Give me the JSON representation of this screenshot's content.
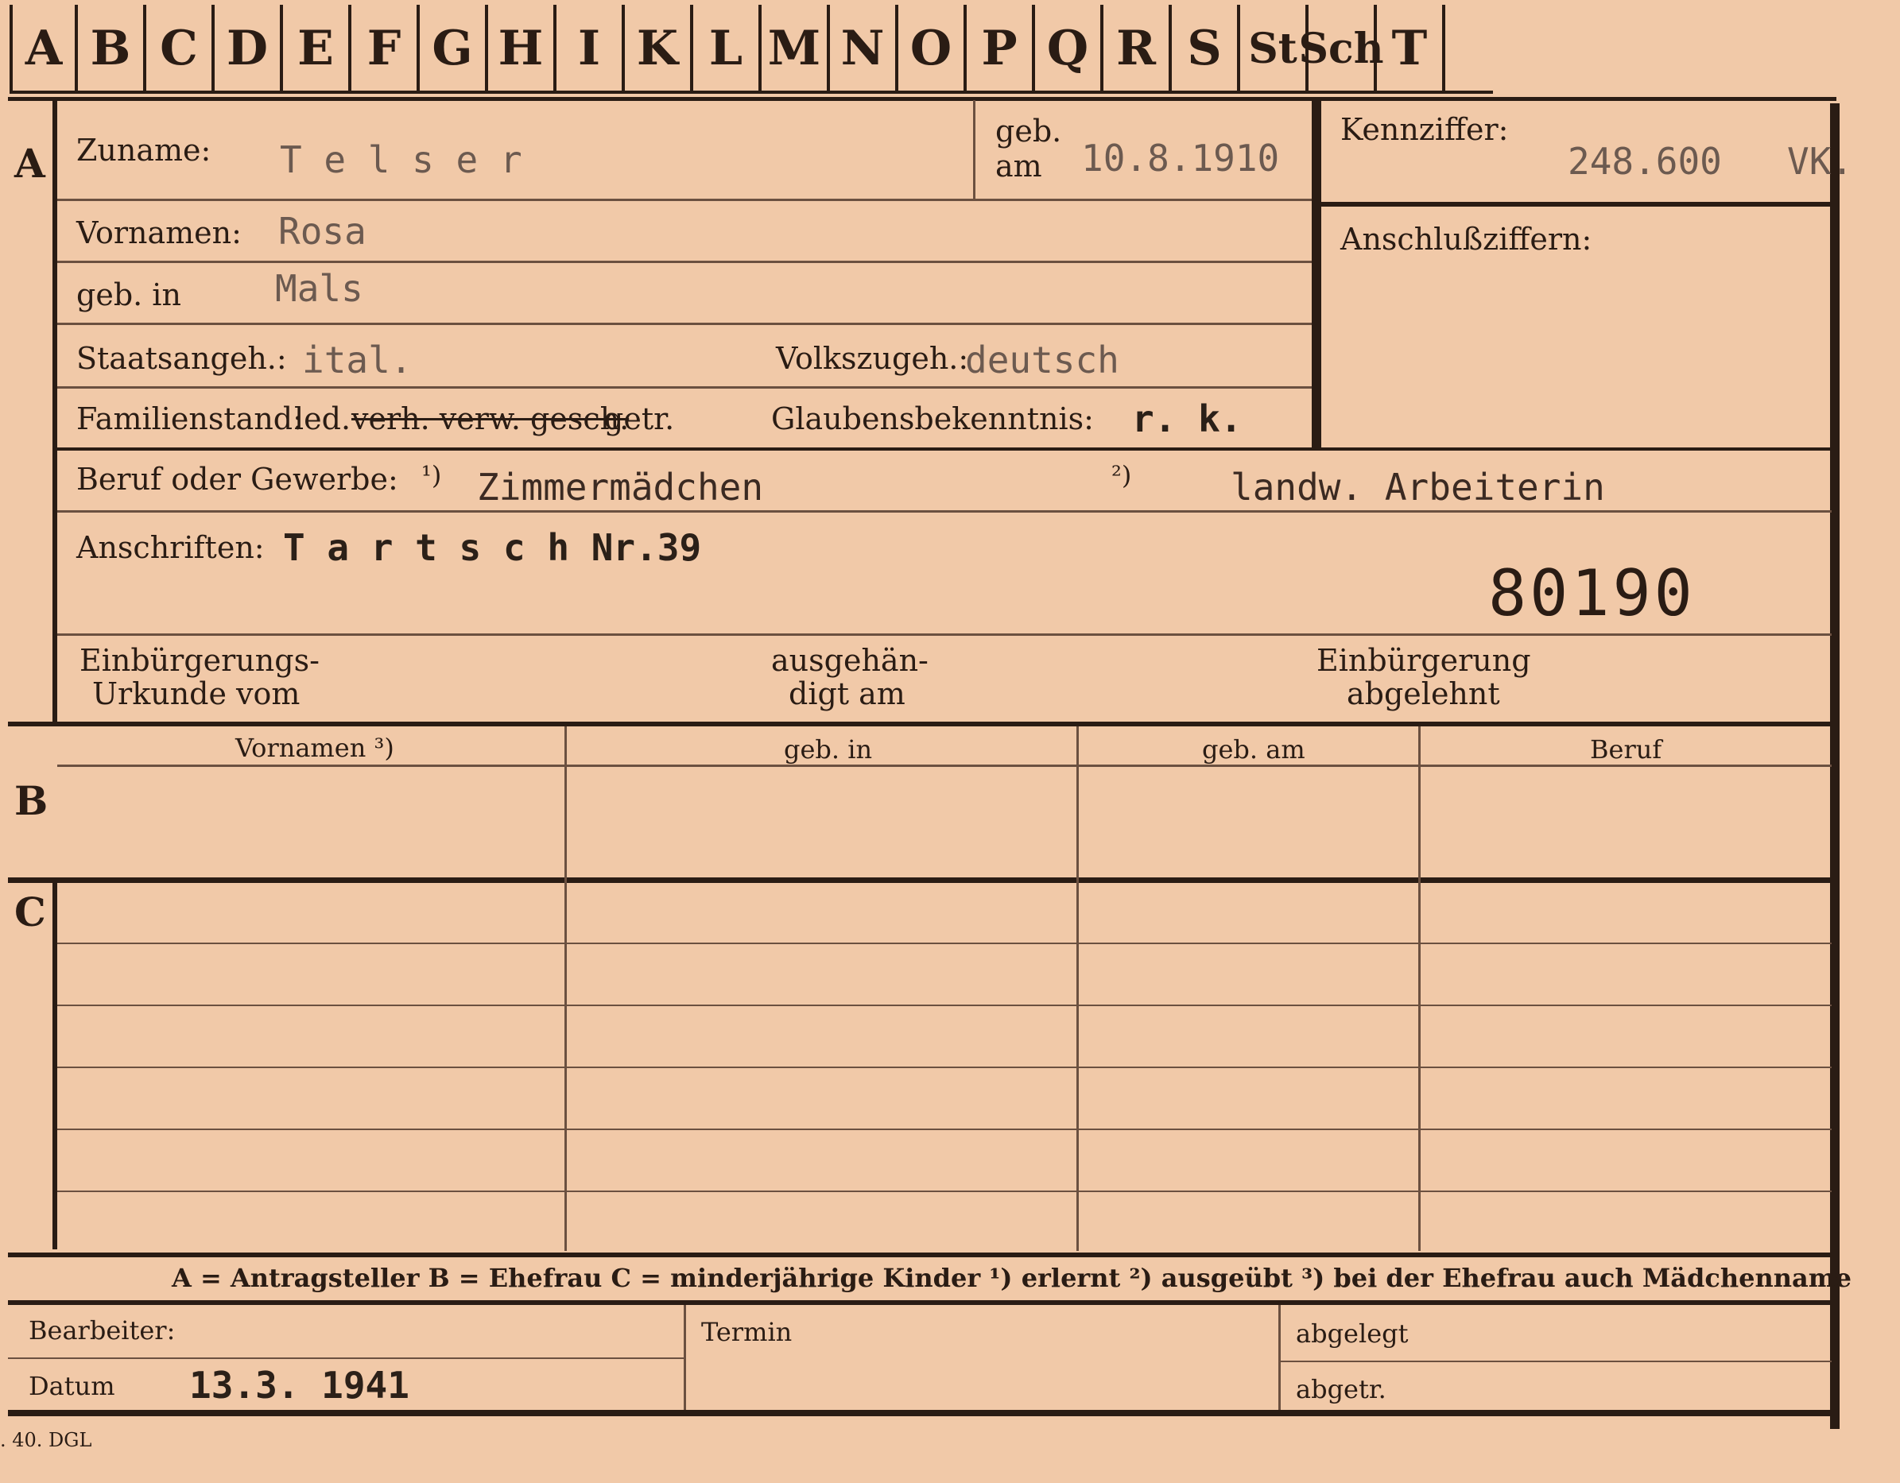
{
  "tabs": [
    "A",
    "B",
    "C",
    "D",
    "E",
    "F",
    "G",
    "H",
    "I",
    "K",
    "L",
    "M",
    "N",
    "O",
    "P",
    "Q",
    "R",
    "S",
    "St",
    "Sch",
    "T"
  ],
  "sections": {
    "a": "A",
    "b": "B",
    "c": "C"
  },
  "form": {
    "zuname_label": "Zuname:",
    "zuname_value": "T e l s e r",
    "geb_label": "geb.",
    "am_label": "am",
    "geb_am_value": "10.8.1910",
    "kennziffer_label": "Kennziffer:",
    "kennziffer_value": "248.600",
    "kennziffer_suffix": "VK.",
    "anschlussziffern_label": "Anschlußziffern:",
    "vornamen_label": "Vornamen:",
    "vornamen_value": "Rosa",
    "geb_in_label": "geb. in",
    "geb_in_value": "Mals",
    "staatsangeh_label": "Staatsangeh.:",
    "staatsangeh_value": "ital.",
    "volkszugeh_label": "Volkszugeh.:",
    "volkszugeh_value": "deutsch",
    "familienstand_label": "Familienstand:",
    "familienstand_led": "led.",
    "familienstand_struck": "verh. verw. gesch.",
    "familienstand_getr": "getr.",
    "glauben_label": "Glaubensbekenntnis:",
    "glauben_value": "r. k.",
    "beruf_label": "Beruf oder Gewerbe:",
    "beruf_mark1": "¹)",
    "beruf_value1": "Zimmermädchen",
    "beruf_mark2": "²)",
    "beruf_value2": "landw. Arbeiterin",
    "anschriften_label": "Anschriften:",
    "anschriften_value": "T a r t s c h  Nr.39",
    "stamp_number": "80190",
    "einb_urkunde_line1": "Einbürgerungs-",
    "einb_urkunde_line2": "Urkunde vom",
    "ausgehaendigt_line1": "ausgehän-",
    "ausgehaendigt_line2": "digt am",
    "einb_abgelehnt_line1": "Einbürgerung",
    "einb_abgelehnt_line2": "abgelehnt"
  },
  "table": {
    "headers": [
      "Vornamen ³)",
      "geb. in",
      "geb. am",
      "Beruf"
    ]
  },
  "legend": "A = Antragsteller   B = Ehefrau   C = minderjährige Kinder   ¹) erlernt   ²) ausgeübt   ³) bei der Ehefrau auch Mädchenname",
  "footer": {
    "bearbeiter_label": "Bearbeiter:",
    "datum_label": "Datum",
    "datum_value": "13.3. 1941",
    "termin_label": "Termin",
    "abgelegt_label": "abgelegt",
    "abgetr_label": "abgetr."
  },
  "print_code": ". 40. DGL"
}
